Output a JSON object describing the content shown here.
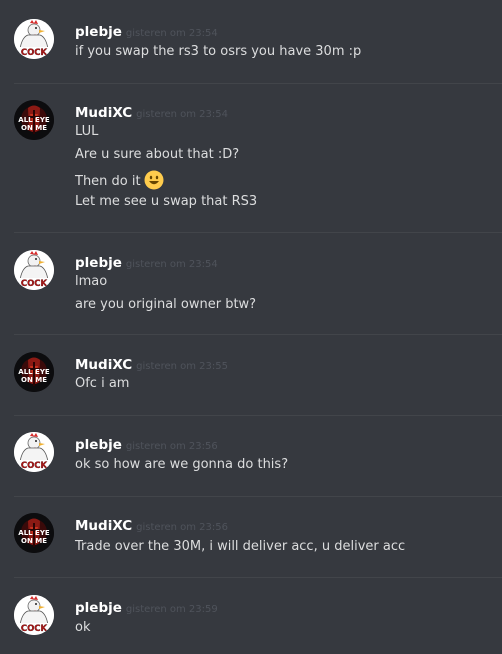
{
  "messages": [
    {
      "user": "plebje",
      "time": "gisteren om 23:54",
      "avatar": "chicken",
      "avatar_text": "COCK",
      "lines": [
        "if you swap the rs3 to osrs you have 30m :p"
      ]
    },
    {
      "user": "MudiXC",
      "time": "gisteren om 23:54",
      "avatar": "demon",
      "avatar_text_top": "ALL EYE",
      "avatar_text_bottom": "ON ME",
      "lines": [
        "LUL",
        "Are u sure about that :D?",
        "Then do it",
        "Let me see u swap that RS3"
      ]
    },
    {
      "user": "plebje",
      "time": "gisteren om 23:54",
      "avatar": "chicken",
      "avatar_text": "COCK",
      "lines": [
        "lmao",
        "are you original owner btw?"
      ]
    },
    {
      "user": "MudiXC",
      "time": "gisteren om 23:55",
      "avatar": "demon",
      "avatar_text_top": "ALL EYE",
      "avatar_text_bottom": "ON ME",
      "lines": [
        "Ofc i am"
      ]
    },
    {
      "user": "plebje",
      "time": "gisteren om 23:56",
      "avatar": "chicken",
      "avatar_text": "COCK",
      "lines": [
        "ok so how are we gonna do this?"
      ]
    },
    {
      "user": "MudiXC",
      "time": "gisteren om 23:56",
      "avatar": "demon",
      "avatar_text_top": "ALL EYE",
      "avatar_text_bottom": "ON ME",
      "lines": [
        "Trade over the 30M, i will deliver acc, u deliver acc"
      ]
    },
    {
      "user": "plebje",
      "time": "gisteren om 23:59",
      "avatar": "chicken",
      "avatar_text": "COCK",
      "lines": [
        "ok"
      ]
    }
  ],
  "emoji": {
    "name": "smiley-emoji",
    "color": "#ffcc4d"
  },
  "colors": {
    "background": "#36393f",
    "username": "#ffffff",
    "text": "#dcddde",
    "timestamp": "#4f535b",
    "divider": "#42454a"
  }
}
